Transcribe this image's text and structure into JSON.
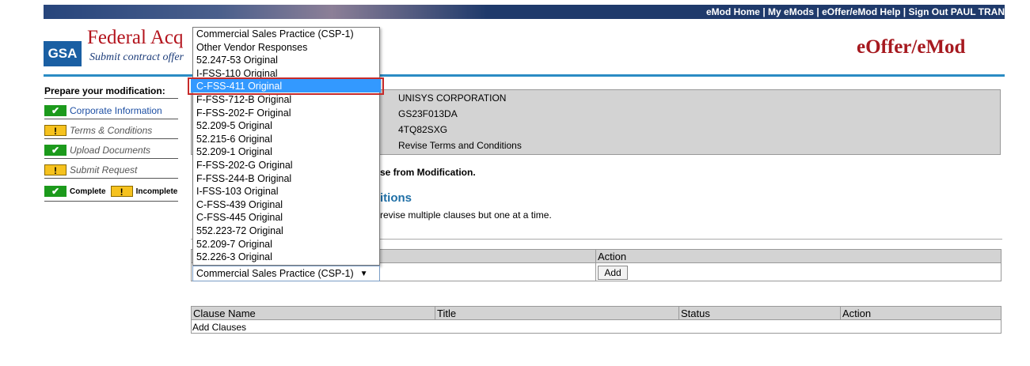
{
  "topbar": {
    "links": [
      "eMod Home",
      "My eMods",
      "eOffer/eMod Help",
      "Sign Out PAUL TRAN"
    ],
    "separator": " | "
  },
  "header": {
    "logo_text": "GSA",
    "title": "Federal Acq",
    "subtitle": "Submit contract offer",
    "app_title": "eOffer/eMod"
  },
  "sidebar": {
    "title": "Prepare your modification:",
    "items": [
      {
        "label": "Corporate Information",
        "status": "complete"
      },
      {
        "label": "Terms & Conditions",
        "status": "incomplete"
      },
      {
        "label": "Upload Documents",
        "status": "complete"
      },
      {
        "label": "Submit Request",
        "status": "incomplete"
      }
    ],
    "legend": {
      "complete": "Complete",
      "incomplete": "Incomplete"
    }
  },
  "info": {
    "company": "UNISYS CORPORATION",
    "contract": "GS23F013DA",
    "mod_id": "4TQ82SXG",
    "mod_type": "Revise Terms and Conditions"
  },
  "main": {
    "remove_note": "se from Modification.",
    "section_title": "itions",
    "section_note": "revise multiple clauses but one at a time."
  },
  "add_table": {
    "action_header": "Action",
    "add_button": "Add"
  },
  "clause_table": {
    "headers": [
      "Clause Name",
      "Title",
      "Status",
      "Action"
    ],
    "empty_text": "Add Clauses"
  },
  "dropdown": {
    "selected": "Commercial Sales Practice (CSP-1)",
    "highlighted_index": 4,
    "options": [
      "Commercial Sales Practice (CSP-1)",
      "Other Vendor Responses",
      "52.247-53 Original",
      "I-FSS-110 Original",
      "C-FSS-411 Original",
      "F-FSS-712-B Original",
      "F-FSS-202-F Original",
      "52.209-5 Original",
      "52.215-6 Original",
      "52.209-1 Original",
      "F-FSS-202-G Original",
      "F-FSS-244-B Original",
      "I-FSS-103 Original",
      "C-FSS-439 Original",
      "C-FSS-445 Original",
      "552.223-72 Original",
      "52.209-7 Original",
      "52.226-3 Original"
    ]
  }
}
